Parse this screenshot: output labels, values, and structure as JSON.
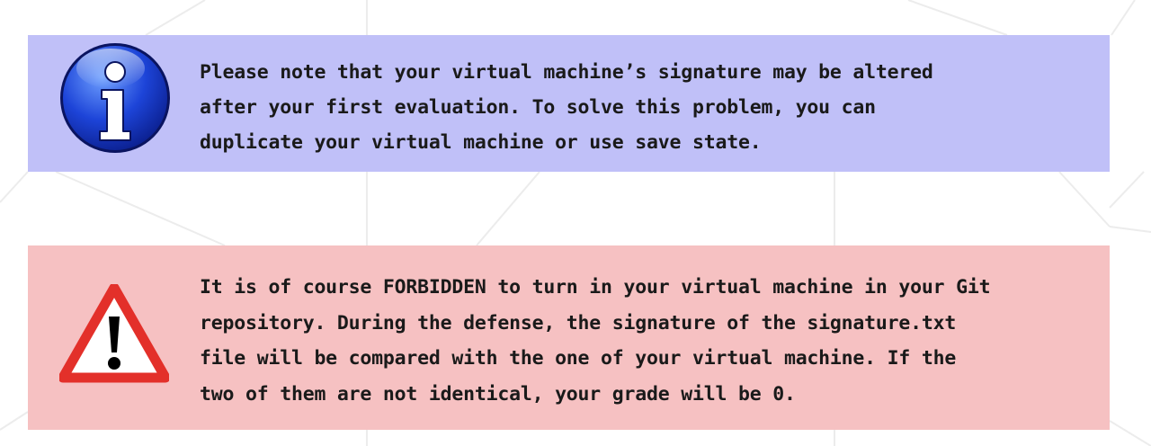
{
  "info_notice": {
    "icon": "info-icon",
    "color": "#c0c0f8",
    "text": "Please note that your virtual machine’s signature may be altered\nafter your first evaluation.  To solve this problem, you can\nduplicate your virtual machine or use save state."
  },
  "warning_notice": {
    "icon": "warning-icon",
    "color": "#f6c1c2",
    "text": "It is of course FORBIDDEN to turn in your virtual machine in your Git\nrepository.  During the defense, the signature of the signature.txt\nfile will be compared with the one of your virtual machine.  If the\ntwo of them are not identical, your grade will be 0."
  }
}
